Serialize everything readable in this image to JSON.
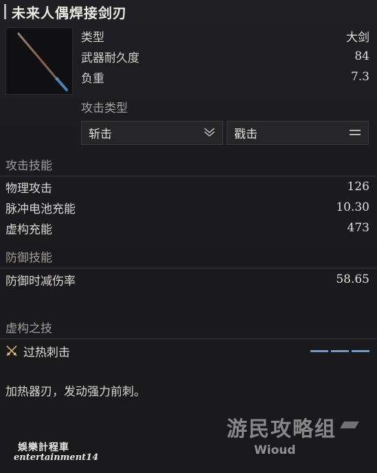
{
  "title": "未来人偶焊接剑刃",
  "thumbnail_icon": "sword-icon",
  "properties": [
    {
      "label": "类型",
      "value": "大剑"
    },
    {
      "label": "武器耐久度",
      "value": "84"
    },
    {
      "label": "负重",
      "value": "7.3"
    }
  ],
  "attack_type": {
    "label": "攻击类型",
    "options": [
      {
        "label": "斩击",
        "icon": "slash-chevron-icon"
      },
      {
        "label": "戳击",
        "icon": "thrust-equals-icon"
      }
    ]
  },
  "attack_skill": {
    "header": "攻击技能",
    "rows": [
      {
        "label": "物理攻击",
        "value": "126"
      },
      {
        "label": "脉冲电池充能",
        "value": "10.30"
      },
      {
        "label": "虚构充能",
        "value": "473"
      }
    ]
  },
  "defense_skill": {
    "header": "防御技能",
    "rows": [
      {
        "label": "防御时减伤率",
        "value": "58.65"
      }
    ]
  },
  "fable_skill": {
    "header": "虚构之技",
    "name": "过热刺击",
    "icon": "crossed-swords-icon",
    "bar_count": 3,
    "bar_color": "#6f9ac4"
  },
  "description": "加热器刃，发动强力前刺。",
  "watermark_left": {
    "line1": "娛樂計程車",
    "line2": "entertainment14"
  },
  "watermark_right": {
    "logo": "游民攻略组",
    "author": "Wioud"
  }
}
